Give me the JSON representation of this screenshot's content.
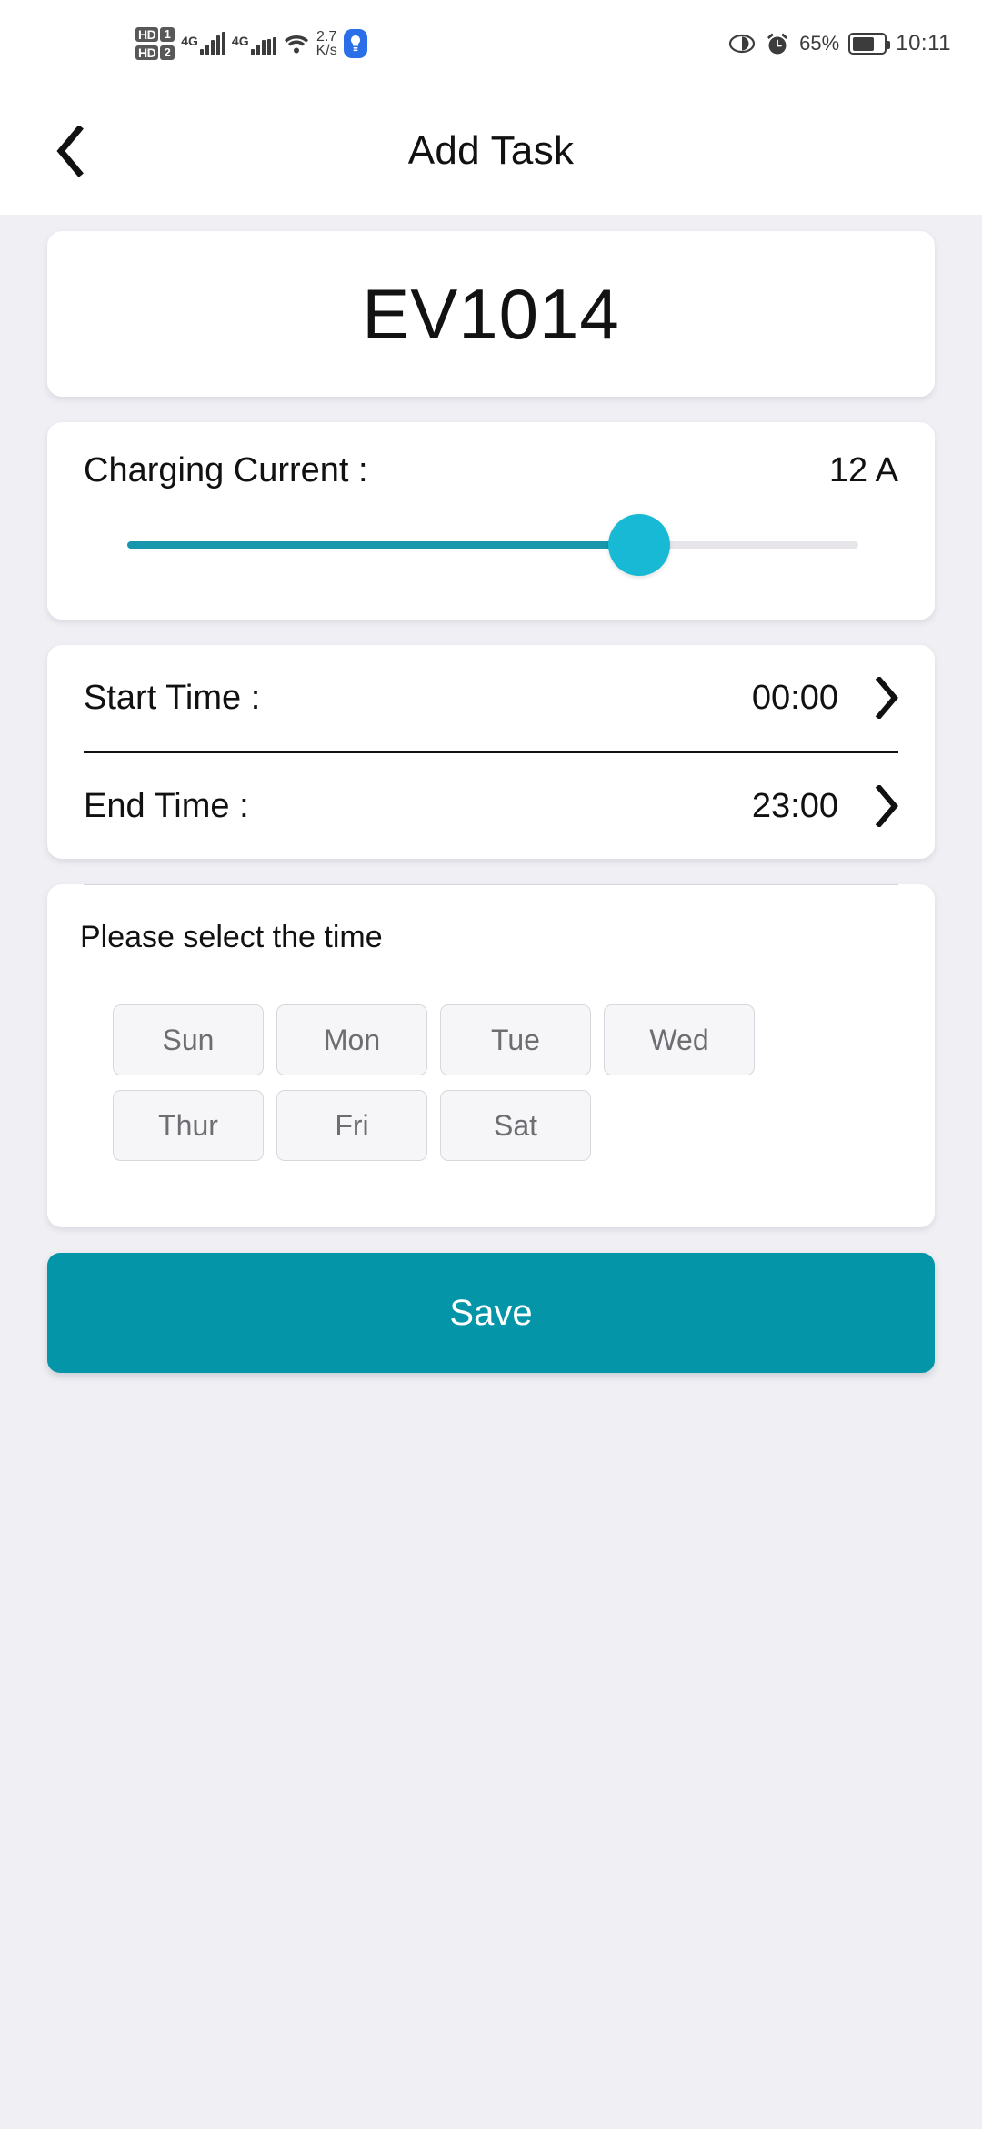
{
  "status_bar": {
    "sim1_label": "HD",
    "sim1_num": "1",
    "sim2_label": "HD",
    "sim2_num": "2",
    "net1": "4G",
    "net2": "4G",
    "data_speed": "2.7",
    "data_speed_unit": "K/s",
    "battery_percent": "65%",
    "time": "10:11",
    "icons": {
      "wifi": "wifi-icon",
      "bulb": "bulb-icon",
      "eye": "eye-icon",
      "alarm": "alarm-icon",
      "battery": "battery-icon"
    }
  },
  "header": {
    "title": "Add Task",
    "back_icon": "chevron-left-icon"
  },
  "device": {
    "name": "EV1014"
  },
  "charging_current": {
    "label": "Charging Current :",
    "value": "12 A",
    "slider": {
      "percent": 70,
      "active_color": "#1896ab",
      "thumb_color": "#17b9d4",
      "inactive_color": "#e7e5ea"
    }
  },
  "times": {
    "start": {
      "label": "Start Time :",
      "value": "00:00",
      "chevron": "chevron-right-icon"
    },
    "end": {
      "label": "End Time :",
      "value": "23:00",
      "chevron": "chevron-right-icon"
    }
  },
  "days_section": {
    "title": "Please select the time",
    "days": [
      {
        "label": "Sun",
        "selected": false
      },
      {
        "label": "Mon",
        "selected": false
      },
      {
        "label": "Tue",
        "selected": false
      },
      {
        "label": "Wed",
        "selected": false
      },
      {
        "label": "Thur",
        "selected": false
      },
      {
        "label": "Fri",
        "selected": false
      },
      {
        "label": "Sat",
        "selected": false
      }
    ]
  },
  "save": {
    "label": "Save",
    "color": "#0495a8"
  }
}
